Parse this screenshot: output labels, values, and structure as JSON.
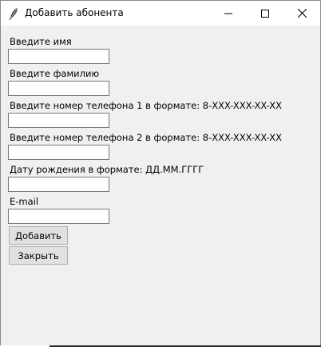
{
  "window": {
    "title": "Добавить абонента",
    "title_icon": "feather-icon",
    "controls": {
      "minimize_icon": "minimize-icon",
      "maximize_icon": "maximize-icon",
      "close_icon": "close-icon"
    }
  },
  "form": {
    "fields": [
      {
        "label": "Введите имя",
        "value": ""
      },
      {
        "label": "Введите фамилию",
        "value": ""
      },
      {
        "label": "Введите номер телефона 1 в формате: 8-XXX-XXX-XX-XX",
        "value": ""
      },
      {
        "label": "Введите номер телефона 2 в формате: 8-XXX-XXX-XX-XX",
        "value": ""
      },
      {
        "label": "Дату рождения в формате: ДД.ММ.ГГГГ",
        "value": ""
      },
      {
        "label": "E-mail",
        "value": ""
      }
    ],
    "buttons": {
      "add": "Добавить",
      "close": "Закрыть"
    }
  }
}
